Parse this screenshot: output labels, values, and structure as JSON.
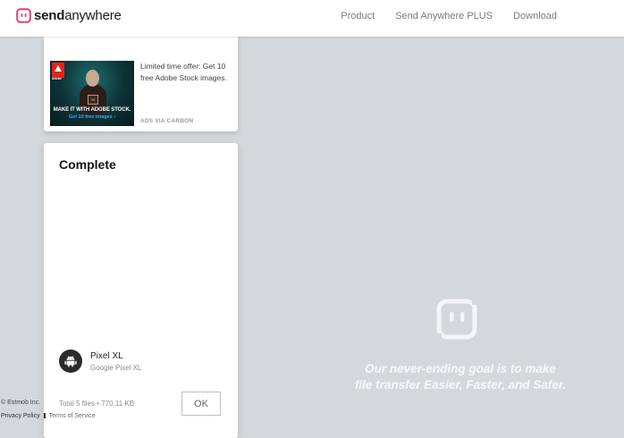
{
  "header": {
    "brand_bold": "send",
    "brand_light": "anywhere",
    "nav": [
      "Product",
      "Send Anywhere PLUS",
      "Download"
    ]
  },
  "ad": {
    "headline": "MAKE IT WITH ADOBE STOCK.",
    "sub": "Get 10 free images ›",
    "brand_tag": "Adobe",
    "badge": "St",
    "text": "Limited time offer: Get 10 free Adobe Stock images.",
    "via": "ADS VIA CARBON"
  },
  "complete": {
    "title": "Complete",
    "device_name": "Pixel XL",
    "device_model": "Google Pixel XL",
    "total": "Total 5 files • 770.11 KB",
    "ok_label": "OK"
  },
  "footer": {
    "copyright": "© Estmob Inc.",
    "privacy": "Privacy Policy",
    "terms": "Terms of Service"
  },
  "hero": {
    "line1": "Our never-ending goal is to make",
    "line2": "file transfer Easier, Faster, and Safer."
  },
  "colors": {
    "brand": "#e0426f",
    "background": "#d3d8dd",
    "card": "#ffffff"
  }
}
